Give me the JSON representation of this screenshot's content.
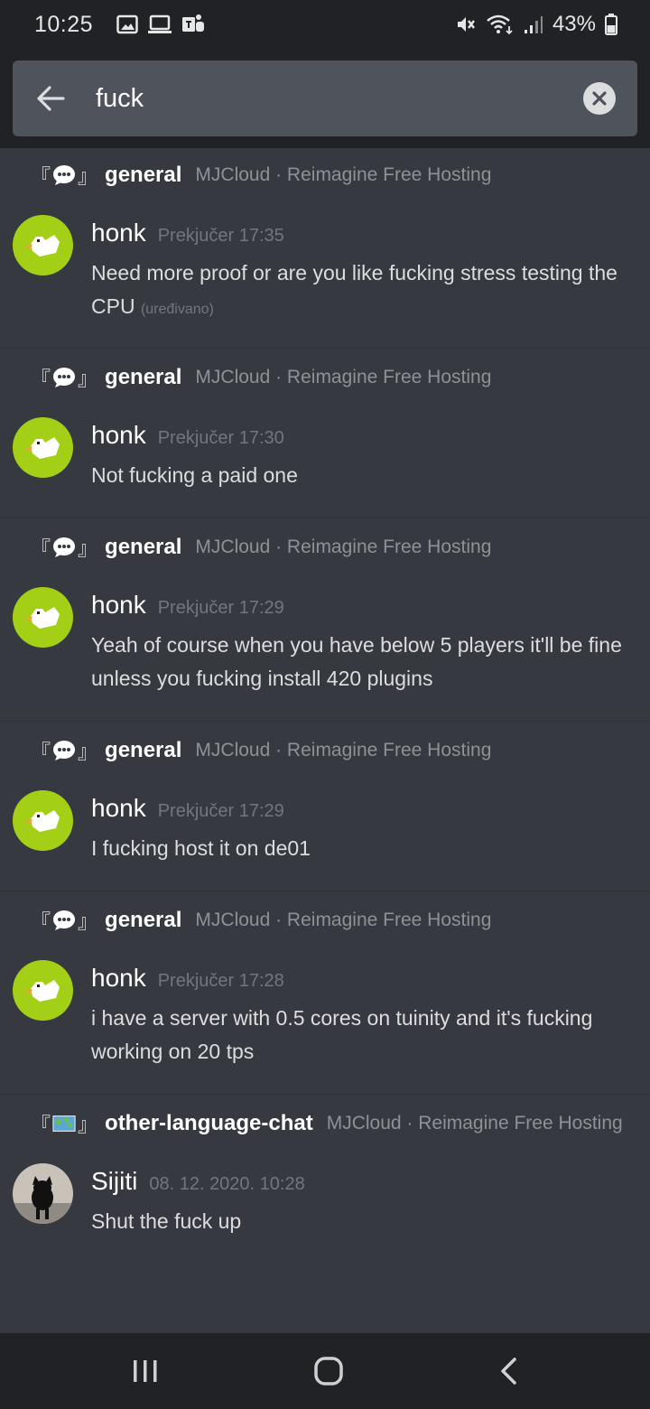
{
  "status_bar": {
    "time": "10:25",
    "battery": "43%"
  },
  "search": {
    "query": "fuck"
  },
  "results": [
    {
      "channel": "general",
      "channel_icon": "speech-bubble-icon",
      "guild": "MJCloud · Reimagine Free Hosting",
      "author": "honk",
      "avatar": "duck-avatar",
      "timestamp": "Prekjučer 17:35",
      "content": "Need more proof or are you like fucking stress testing the CPU",
      "edited": "(uređivano)"
    },
    {
      "channel": "general",
      "channel_icon": "speech-bubble-icon",
      "guild": "MJCloud · Reimagine Free Hosting",
      "author": "honk",
      "avatar": "duck-avatar",
      "timestamp": "Prekjučer 17:30",
      "content": "Not fucking a paid one"
    },
    {
      "channel": "general",
      "channel_icon": "speech-bubble-icon",
      "guild": "MJCloud · Reimagine Free Hosting",
      "author": "honk",
      "avatar": "duck-avatar",
      "timestamp": "Prekjučer 17:29",
      "content": "Yeah of course when you have below 5 players it'll be fine unless you fucking install 420 plugins"
    },
    {
      "channel": "general",
      "channel_icon": "speech-bubble-icon",
      "guild": "MJCloud · Reimagine Free Hosting",
      "author": "honk",
      "avatar": "duck-avatar",
      "timestamp": "Prekjučer 17:29",
      "content": "I fucking host it on de01"
    },
    {
      "channel": "general",
      "channel_icon": "speech-bubble-icon",
      "guild": "MJCloud · Reimagine Free Hosting",
      "author": "honk",
      "avatar": "duck-avatar",
      "timestamp": "Prekjučer 17:28",
      "content": "i have a server with 0.5 cores on tuinity and it's fucking working on 20 tps"
    },
    {
      "channel": "other-language-chat",
      "channel_icon": "world-map-icon",
      "guild": "MJCloud · Reimagine Free Hosting",
      "author": "Sijiti",
      "avatar": "black-cat-avatar",
      "timestamp": "08. 12. 2020. 10:28",
      "content": "Shut the fuck up"
    }
  ],
  "colors": {
    "background": "#36393f",
    "bar": "#202225",
    "search_field": "#4f545c",
    "avatar_green": "#a3d016"
  }
}
